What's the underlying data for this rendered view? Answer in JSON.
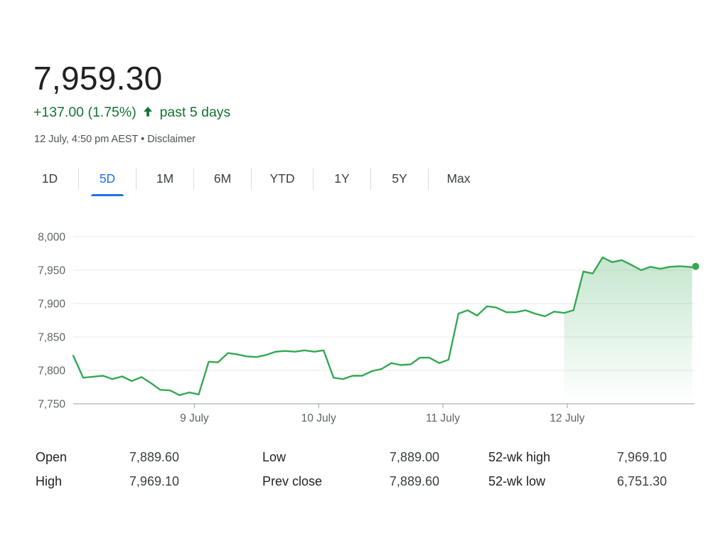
{
  "quote": {
    "price": "7,959.30",
    "change": "+137.00 (1.75%)",
    "period": "past 5 days",
    "timestamp": "12 July, 4:50 pm AEST • Disclaimer"
  },
  "tabs": [
    {
      "label": "1D",
      "active": false
    },
    {
      "label": "5D",
      "active": true
    },
    {
      "label": "1M",
      "active": false
    },
    {
      "label": "6M",
      "active": false
    },
    {
      "label": "YTD",
      "active": false
    },
    {
      "label": "1Y",
      "active": false
    },
    {
      "label": "5Y",
      "active": false
    },
    {
      "label": "Max",
      "active": false
    }
  ],
  "colors": {
    "up": "#137333",
    "line": "#34a853",
    "active_tab": "#1a73e8",
    "grid": "#e8eaed",
    "axis_text": "#5f6368"
  },
  "chart_data": {
    "type": "area",
    "title": "",
    "xlabel": "",
    "ylabel": "",
    "ylim": [
      7750,
      8000
    ],
    "yticks": [
      {
        "value": 8000,
        "label": "8,000"
      },
      {
        "value": 7950,
        "label": "7,950"
      },
      {
        "value": 7900,
        "label": "7,900"
      },
      {
        "value": 7850,
        "label": "7,850"
      },
      {
        "value": 7800,
        "label": "7,800"
      },
      {
        "value": 7750,
        "label": "7,750"
      }
    ],
    "xlim": [
      0,
      100
    ],
    "xticks": [
      {
        "value": 19.5,
        "label": "9 July"
      },
      {
        "value": 39.5,
        "label": "10 July"
      },
      {
        "value": 59.5,
        "label": "11 July"
      },
      {
        "value": 79.5,
        "label": "12 July"
      }
    ],
    "grid": true,
    "series": [
      {
        "values": [
          [
            0.0,
            7822
          ],
          [
            1.6,
            7789
          ],
          [
            4.8,
            7792
          ],
          [
            6.3,
            7787
          ],
          [
            7.9,
            7791
          ],
          [
            9.4,
            7784
          ],
          [
            11.0,
            7790
          ],
          [
            12.5,
            7781
          ],
          [
            14.0,
            7771
          ],
          [
            15.6,
            7770
          ],
          [
            17.1,
            7763
          ],
          [
            18.7,
            7767
          ],
          [
            20.2,
            7764
          ],
          [
            21.8,
            7813
          ],
          [
            23.3,
            7812
          ],
          [
            24.9,
            7826
          ],
          [
            26.4,
            7824
          ],
          [
            27.9,
            7821
          ],
          [
            29.5,
            7820
          ],
          [
            31.0,
            7823
          ],
          [
            32.6,
            7828
          ],
          [
            34.1,
            7829
          ],
          [
            35.7,
            7828
          ],
          [
            37.2,
            7830
          ],
          [
            38.8,
            7828
          ],
          [
            40.3,
            7830
          ],
          [
            41.9,
            7789
          ],
          [
            43.4,
            7787
          ],
          [
            45.0,
            7792
          ],
          [
            46.5,
            7792
          ],
          [
            48.1,
            7799
          ],
          [
            49.6,
            7802
          ],
          [
            51.2,
            7811
          ],
          [
            52.7,
            7808
          ],
          [
            54.3,
            7809
          ],
          [
            55.8,
            7819
          ],
          [
            57.3,
            7819
          ],
          [
            58.9,
            7811
          ],
          [
            60.4,
            7816
          ],
          [
            62.0,
            7885
          ],
          [
            63.5,
            7890
          ],
          [
            65.0,
            7882
          ],
          [
            66.6,
            7896
          ],
          [
            68.1,
            7894
          ],
          [
            69.7,
            7887
          ],
          [
            71.2,
            7887
          ],
          [
            72.8,
            7890
          ],
          [
            74.3,
            7885
          ],
          [
            75.9,
            7881
          ],
          [
            77.4,
            7888
          ],
          [
            79.0,
            7886
          ],
          [
            80.5,
            7890
          ],
          [
            82.1,
            7948
          ],
          [
            83.6,
            7945
          ],
          [
            85.2,
            7969
          ],
          [
            86.7,
            7962
          ],
          [
            88.3,
            7965
          ],
          [
            89.8,
            7958
          ],
          [
            91.4,
            7950
          ],
          [
            92.9,
            7955
          ],
          [
            94.5,
            7952
          ],
          [
            96.0,
            7955
          ],
          [
            97.6,
            7956
          ],
          [
            99.1,
            7955
          ],
          [
            99.6,
            7954
          ]
        ]
      }
    ]
  },
  "stats": [
    {
      "label": "Open",
      "value": "7,889.60"
    },
    {
      "label": "High",
      "value": "7,969.10"
    },
    {
      "label": "Low",
      "value": "7,889.00"
    },
    {
      "label": "Prev close",
      "value": "7,889.60"
    },
    {
      "label": "52-wk high",
      "value": "7,969.10"
    },
    {
      "label": "52-wk low",
      "value": "6,751.30"
    }
  ]
}
